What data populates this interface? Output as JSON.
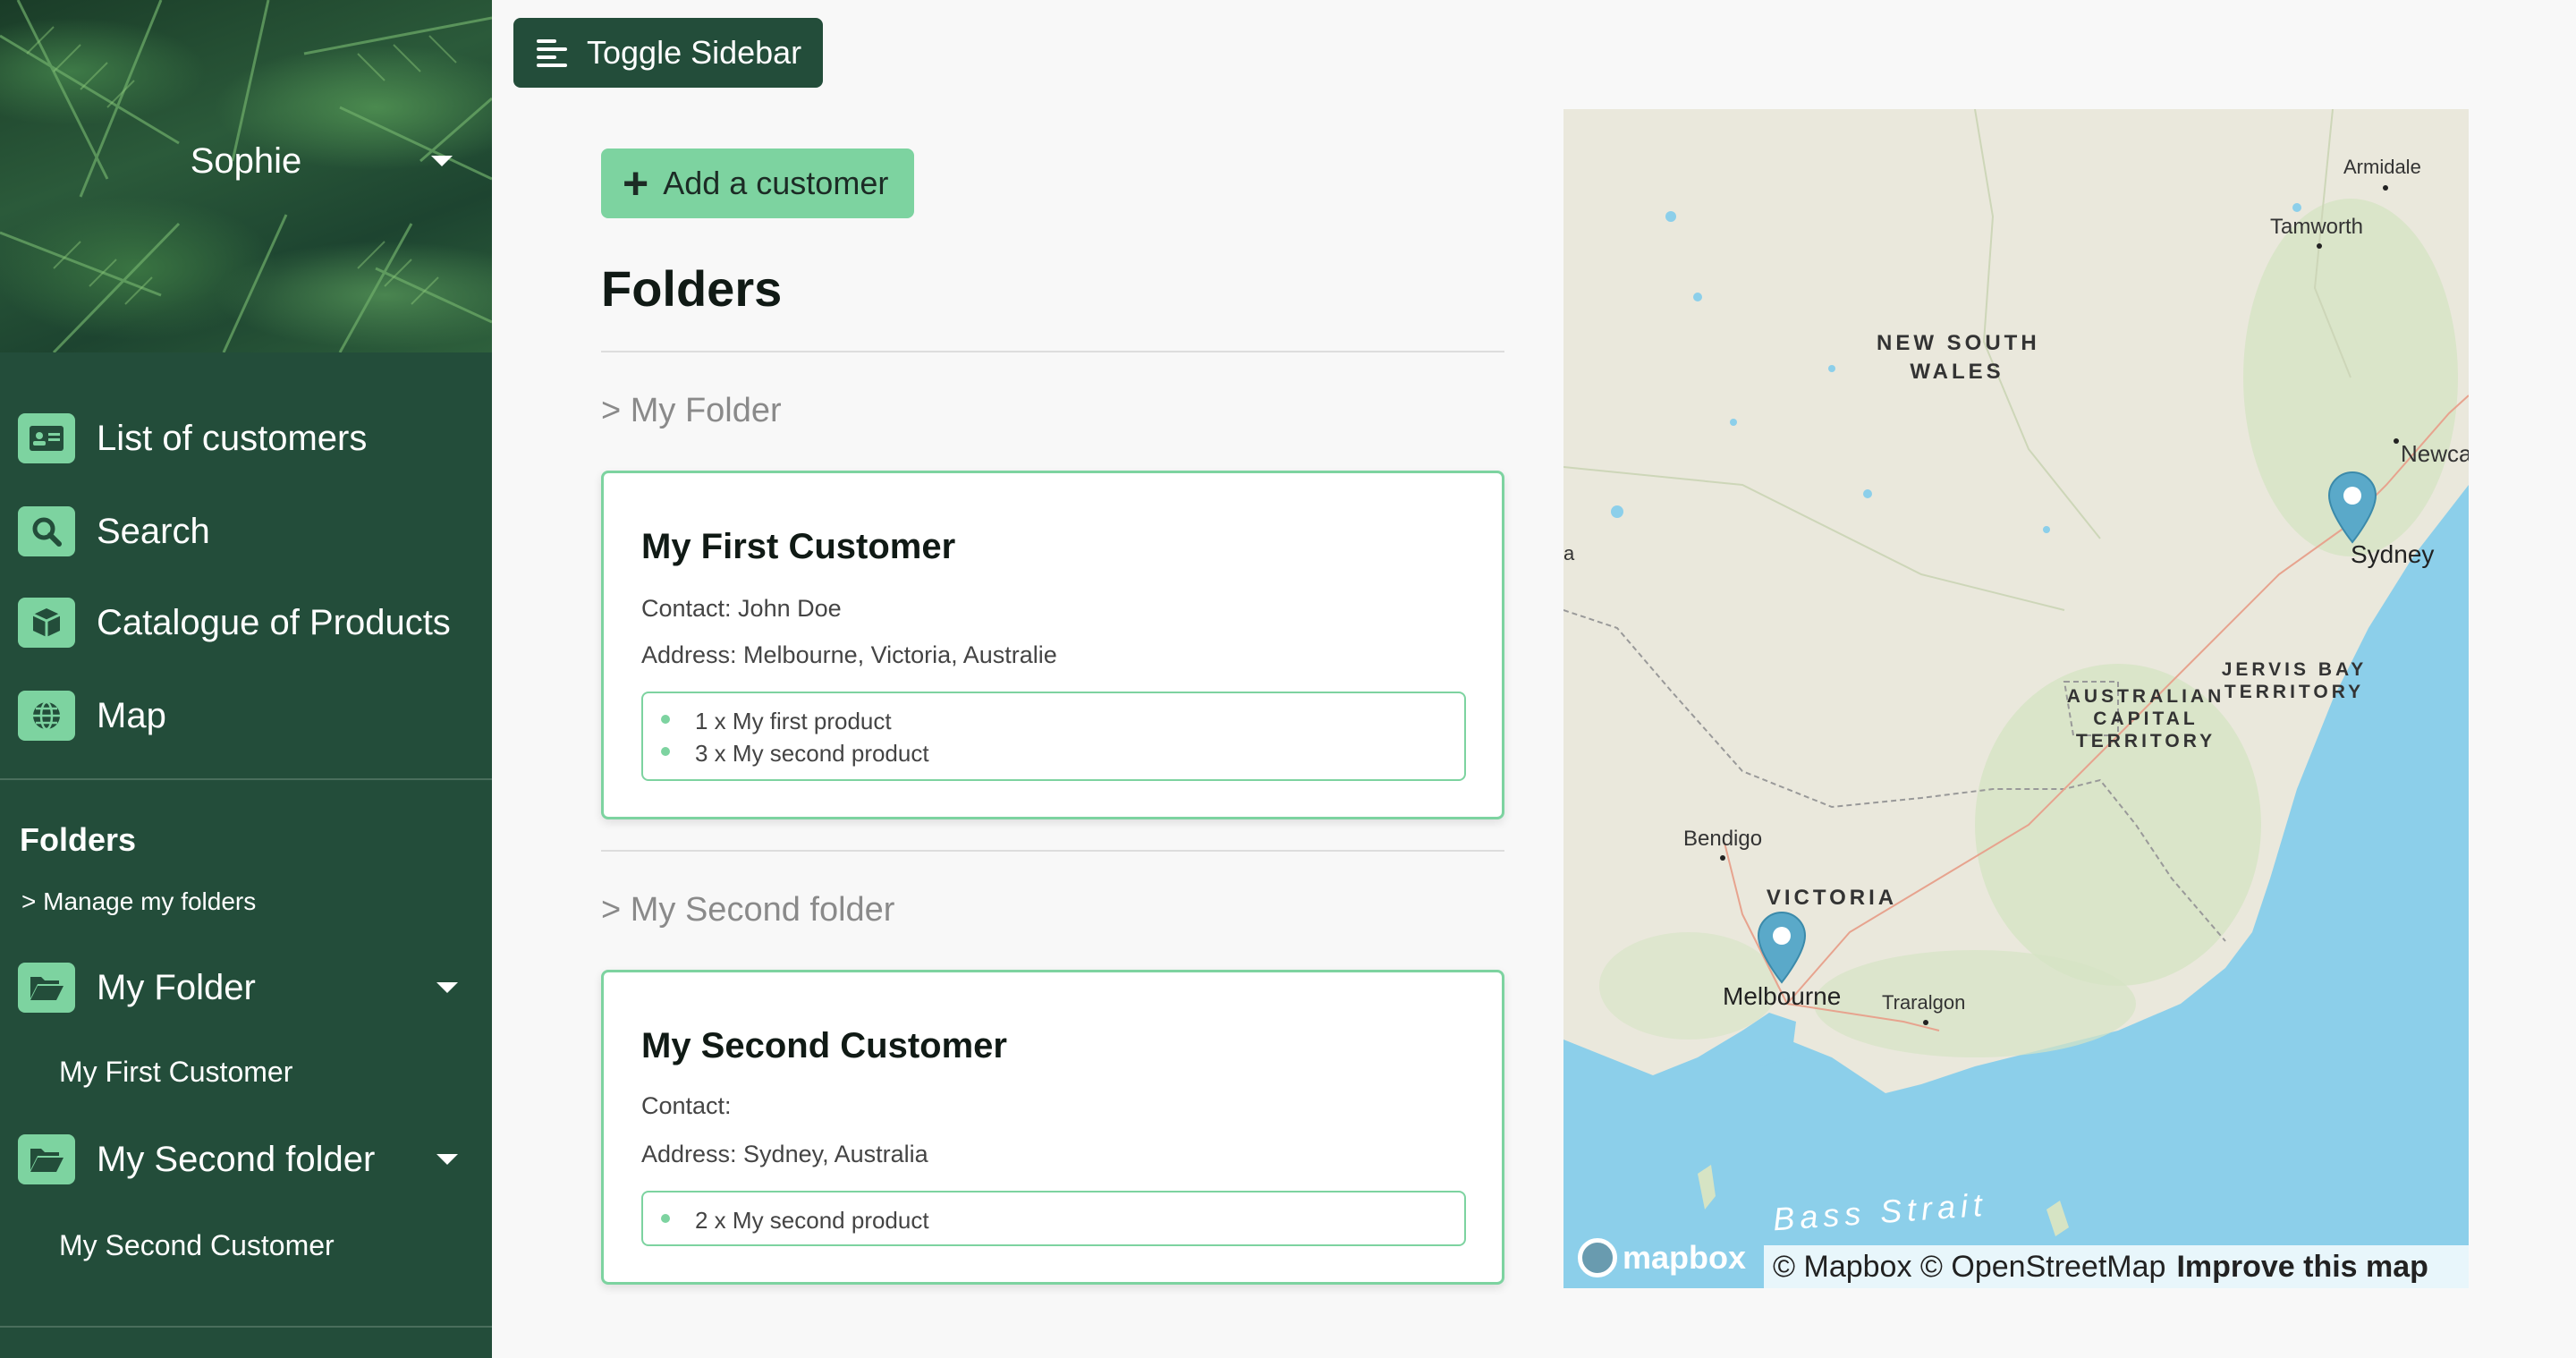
{
  "sidebar": {
    "user_name": "Sophie",
    "nav": [
      {
        "label": "List of customers",
        "icon": "id-card-icon"
      },
      {
        "label": "Search",
        "icon": "search-icon"
      },
      {
        "label": "Catalogue of Products",
        "icon": "box-icon"
      },
      {
        "label": "Map",
        "icon": "globe-icon"
      }
    ],
    "folders_heading": "Folders",
    "manage_folders": "> Manage my folders",
    "folders": [
      {
        "name": "My Folder",
        "customers": [
          "My First Customer"
        ]
      },
      {
        "name": "My Second folder",
        "customers": [
          "My Second Customer"
        ]
      }
    ]
  },
  "toolbar": {
    "toggle_label": "Toggle Sidebar"
  },
  "main": {
    "add_customer_label": "Add a customer",
    "folders_title": "Folders",
    "folders": [
      {
        "link": "> My Folder",
        "customer": {
          "name": "My First Customer",
          "contact": "Contact: John Doe",
          "address": "Address: Melbourne, Victoria, Australie",
          "products": [
            "1 x My first product",
            "3 x My second product"
          ]
        }
      },
      {
        "link": "> My Second folder",
        "customer": {
          "name": "My Second Customer",
          "contact": "Contact:",
          "address": "Address: Sydney, Australia",
          "products": [
            "2 x My second product"
          ]
        }
      }
    ]
  },
  "map": {
    "labels": {
      "armidale": "Armidale",
      "tamworth": "Tamworth",
      "newcastle": "Newca",
      "sydney": "Sydney",
      "nsw": "NEW SOUTH\nWALES",
      "act": "AUSTRALIAN\nCAPITAL\nTERRITORY",
      "jervis": "JERVIS BAY\nTERRITORY",
      "bendigo": "Bendigo",
      "victoria": "VICTORIA",
      "melbourne": "Melbourne",
      "traralgon": "Traralgon",
      "bass_strait": "Bass Strait",
      "edge": "a"
    },
    "logo": "mapbox",
    "attribution": "© Mapbox © OpenStreetMap",
    "improve": "Improve this map"
  },
  "colors": {
    "sidebar_bg": "#234d3a",
    "accent": "#7dd3a0",
    "marker": "#5aa9c9",
    "water": "#8ccfea"
  }
}
